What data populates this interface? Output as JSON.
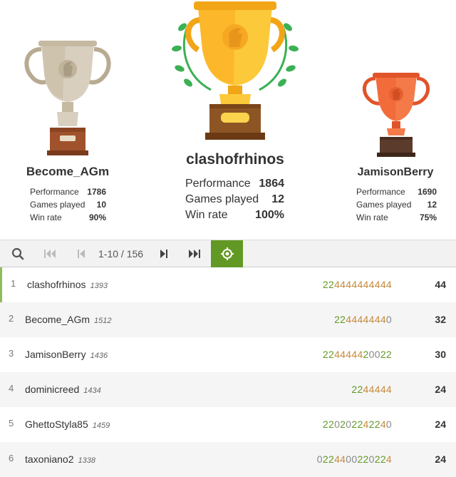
{
  "podium": {
    "first": {
      "name": "clashofrhinos",
      "stats": [
        {
          "label": "Performance",
          "value": "1864"
        },
        {
          "label": "Games played",
          "value": "12"
        },
        {
          "label": "Win rate",
          "value": "100%"
        }
      ]
    },
    "second": {
      "name": "Become_AGm",
      "stats": [
        {
          "label": "Performance",
          "value": "1786"
        },
        {
          "label": "Games played",
          "value": "10"
        },
        {
          "label": "Win rate",
          "value": "90%"
        }
      ]
    },
    "third": {
      "name": "JamisonBerry",
      "stats": [
        {
          "label": "Performance",
          "value": "1690"
        },
        {
          "label": "Games played",
          "value": "12"
        },
        {
          "label": "Win rate",
          "value": "75%"
        }
      ]
    }
  },
  "pager": {
    "page_info": "1-10 / 156",
    "icons": [
      "search-icon",
      "first-page-icon",
      "prev-page-icon",
      "next-page-icon",
      "last-page-icon",
      "crosshair-icon"
    ],
    "accent": "#629924"
  },
  "standings": [
    {
      "rank": "1",
      "name": "clashofrhinos",
      "rating": "1393",
      "sheet": "224444444444",
      "total": "44"
    },
    {
      "rank": "2",
      "name": "Become_AGm",
      "rating": "1512",
      "sheet": "2244444440",
      "total": "32"
    },
    {
      "rank": "3",
      "name": "JamisonBerry",
      "rating": "1436",
      "sheet": "224444420022",
      "total": "30"
    },
    {
      "rank": "4",
      "name": "dominicreed",
      "rating": "1434",
      "sheet": "2244444",
      "total": "24"
    },
    {
      "rank": "5",
      "name": "GhettoStyla85",
      "rating": "1459",
      "sheet": "220202242240",
      "total": "24"
    },
    {
      "rank": "6",
      "name": "taxoniano2",
      "rating": "1338",
      "sheet": "0224400220224",
      "total": "24"
    }
  ],
  "colors": {
    "gold": "#fcb72a",
    "silver": "#cfc5b3",
    "bronze": "#f26b3a",
    "score_green": "#629924",
    "score_orange": "#c68a3c"
  }
}
